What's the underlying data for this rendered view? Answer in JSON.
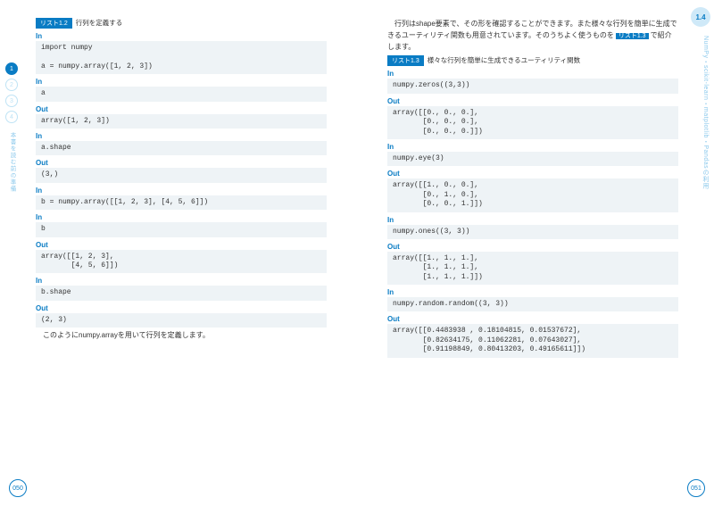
{
  "section_tag": "1.4",
  "right_vtext": "NumPy・scikit-learn・matplotlib・Pandasの利用",
  "nav": {
    "dots": [
      "1",
      "2",
      "3",
      "4"
    ],
    "active": 0,
    "vtext": "本書を読む前の準備"
  },
  "left": {
    "listing": {
      "tag": "リスト1.2",
      "caption": "行列を定義する"
    },
    "cells": [
      {
        "t": "In",
        "c": "import numpy\n\na = numpy.array([1, 2, 3])"
      },
      {
        "t": "In",
        "c": "a"
      },
      {
        "t": "Out",
        "c": "array([1, 2, 3])"
      },
      {
        "t": "In",
        "c": "a.shape"
      },
      {
        "t": "Out",
        "c": "(3,)"
      },
      {
        "t": "In",
        "c": "b = numpy.array([[1, 2, 3], [4, 5, 6]])"
      },
      {
        "t": "In",
        "c": "b"
      },
      {
        "t": "Out",
        "c": "array([[1, 2, 3],\n       [4, 5, 6]])"
      },
      {
        "t": "In",
        "c": "b.shape"
      },
      {
        "t": "Out",
        "c": "(2, 3)"
      }
    ],
    "footer": "　このようにnumpy.arrayを用いて行列を定義します。",
    "pagenum": "050"
  },
  "right": {
    "intro_a": "　行列はshape要素で、その形を確認することができます。また様々な行列を簡単に生成できるユーティリティ関数も用意されています。そのうちよく使うものを",
    "intro_tag": "リスト1.3",
    "intro_b": "で紹介します。",
    "listing": {
      "tag": "リスト1.3",
      "caption": "様々な行列を簡単に生成できるユーティリティ関数"
    },
    "cells": [
      {
        "t": "In",
        "c": "numpy.zeros((3,3))"
      },
      {
        "t": "Out",
        "c": "array([[0., 0., 0.],\n       [0., 0., 0.],\n       [0., 0., 0.]])"
      },
      {
        "t": "In",
        "c": "numpy.eye(3)"
      },
      {
        "t": "Out",
        "c": "array([[1., 0., 0.],\n       [0., 1., 0.],\n       [0., 0., 1.]])"
      },
      {
        "t": "In",
        "c": "numpy.ones((3, 3))"
      },
      {
        "t": "Out",
        "c": "array([[1., 1., 1.],\n       [1., 1., 1.],\n       [1., 1., 1.]])"
      },
      {
        "t": "In",
        "c": "numpy.random.random((3, 3))"
      },
      {
        "t": "Out",
        "c": "array([[0.4483938 , 0.18104815, 0.01537672],\n       [0.82634175, 0.11062281, 0.07643027],\n       [0.91198849, 0.80413203, 0.49165611]])"
      }
    ],
    "pagenum": "051"
  }
}
